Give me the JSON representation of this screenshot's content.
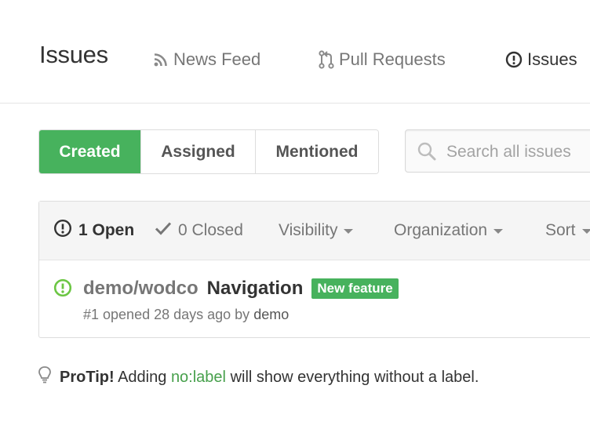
{
  "header": {
    "title": "Issues",
    "nav": [
      {
        "label": "News Feed",
        "icon": "rss-icon"
      },
      {
        "label": "Pull Requests",
        "icon": "git-pull-request-icon"
      },
      {
        "label": "Issues",
        "icon": "issue-opened-icon",
        "active": true
      }
    ]
  },
  "filters": {
    "tabs": [
      {
        "label": "Created",
        "selected": true
      },
      {
        "label": "Assigned",
        "selected": false
      },
      {
        "label": "Mentioned",
        "selected": false
      }
    ]
  },
  "search": {
    "placeholder": "Search all issues",
    "value": ""
  },
  "issues_box": {
    "states": {
      "open_label": "1 Open",
      "closed_label": "0 Closed"
    },
    "filter_menus": [
      "Visibility",
      "Organization",
      "Sort"
    ],
    "issues": [
      {
        "repo": "demo/wodco",
        "title": "Navigation",
        "label": "New feature",
        "meta": "#1 opened 28 days ago by",
        "author": "demo"
      }
    ]
  },
  "protip": {
    "prefix": "ProTip!",
    "text_before": "Adding",
    "code": "no:label",
    "text_after": "will show everything without a label."
  },
  "colors": {
    "accent_green": "#47b25d",
    "open_icon_green": "#6cc644",
    "muted_text": "#767676"
  }
}
